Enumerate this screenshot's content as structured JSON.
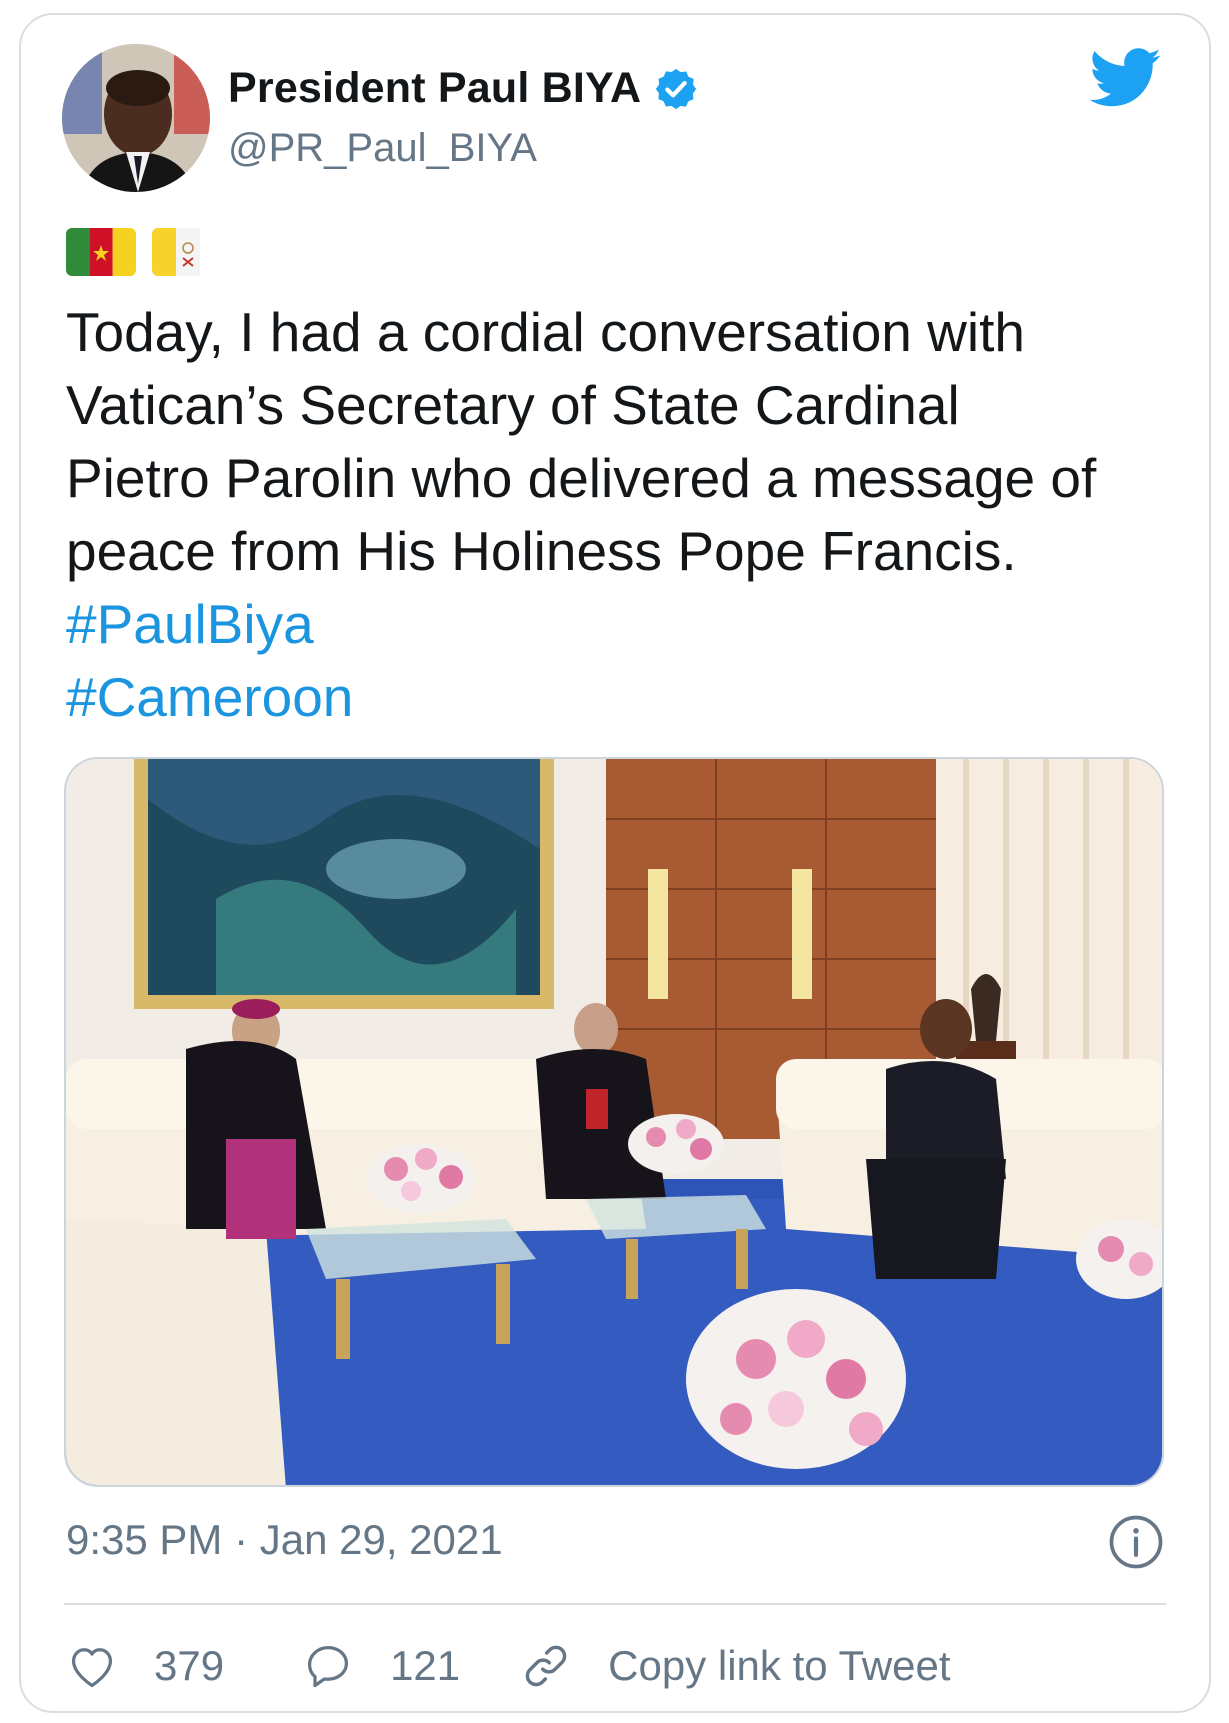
{
  "author": {
    "display_name": "President Paul BIYA",
    "handle": "@PR_Paul_BIYA",
    "verified": true
  },
  "icons": {
    "verified": "verified-badge-icon",
    "brand": "twitter-bird-icon",
    "info": "info-icon",
    "like": "heart-icon",
    "reply": "speech-bubble-icon",
    "link": "link-icon"
  },
  "flags": [
    "cameroon-flag",
    "vatican-flag"
  ],
  "tweet": {
    "text": "Today, I had a cordial conversation with\nVatican’s Secretary of State Cardinal\nPietro Parolin who delivered a message of\npeace from His Holiness Pope Francis.",
    "hashtags": [
      "#PaulBiya",
      "#Cameroon"
    ]
  },
  "meta": {
    "timestamp": "9:35 PM · Jan 29, 2021"
  },
  "actions": {
    "likes": "379",
    "replies": "121",
    "copy_link": "Copy link to Tweet"
  },
  "colors": {
    "link": "#1b95e0",
    "twitter_blue": "#1da1f2",
    "muted": "#657786"
  }
}
